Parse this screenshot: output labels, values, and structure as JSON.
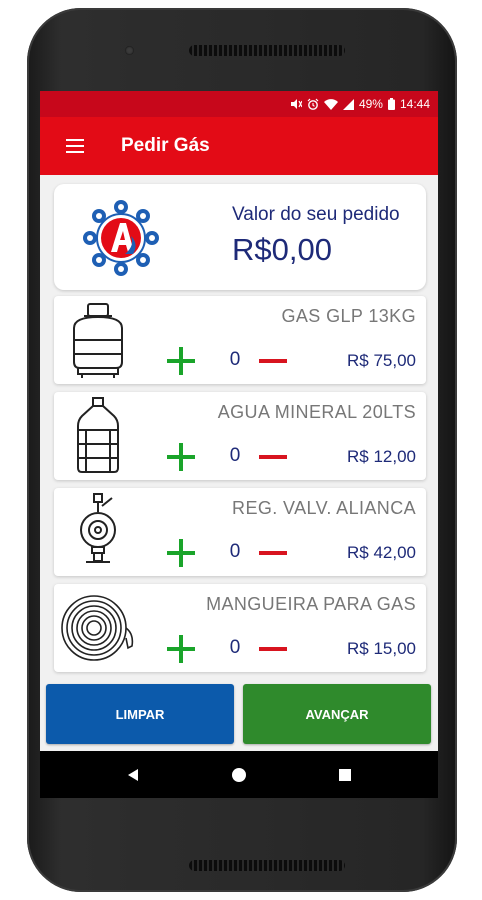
{
  "status_bar": {
    "battery": "49%",
    "time": "14:44",
    "icons": [
      "mute-icon",
      "alarm-icon",
      "wifi-icon",
      "signal-icon",
      "battery-icon"
    ]
  },
  "app_bar": {
    "menu_icon": "hamburger-menu-icon",
    "title": "Pedir Gás"
  },
  "summary": {
    "label": "Valor do seu pedido",
    "value": "R$0,00",
    "colors": {
      "text": "#1e2a78",
      "logo_red": "#e30b16",
      "logo_blue": "#1e5fb4"
    }
  },
  "products": [
    {
      "name": "GAS GLP  13KG",
      "qty": "0",
      "price": "R$ 75,00",
      "icon": "gas-cylinder-icon"
    },
    {
      "name": "AGUA MINERAL 20LTS",
      "qty": "0",
      "price": "R$ 12,00",
      "icon": "water-jug-icon"
    },
    {
      "name": "REG. VALV. ALIANCA",
      "qty": "0",
      "price": "R$ 42,00",
      "icon": "gas-regulator-icon"
    },
    {
      "name": "MANGUEIRA PARA GAS",
      "qty": "0",
      "price": "R$ 15,00",
      "icon": "gas-hose-icon"
    }
  ],
  "actions": {
    "clear_label": "LIMPAR",
    "next_label": "AVANÇAR",
    "colors": {
      "clear": "#0c5aab",
      "next": "#2f8a2c",
      "plus": "#1aa42a",
      "minus": "#d8141f"
    }
  },
  "nav": {
    "icons": [
      "back-icon",
      "home-icon",
      "recents-icon"
    ]
  }
}
